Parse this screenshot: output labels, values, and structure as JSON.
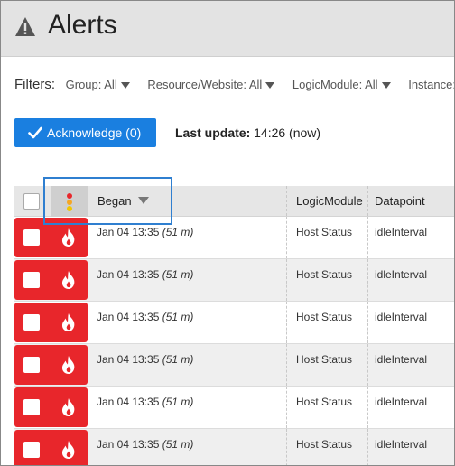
{
  "header": {
    "title": "Alerts",
    "icon": "warning-icon"
  },
  "filters": {
    "label": "Filters:",
    "items": [
      {
        "text": "Group: All"
      },
      {
        "text": "Resource/Website: All"
      },
      {
        "text": "LogicModule: All"
      },
      {
        "text": "Instance:"
      }
    ]
  },
  "toolbar": {
    "acknowledge_label": "Acknowledge (0)",
    "last_update_label": "Last update:",
    "last_update_value": " 14:26 (now)"
  },
  "table": {
    "columns": {
      "began": "Began",
      "logicmodule": "LogicModule",
      "datapoint": "Datapoint"
    },
    "rows": [
      {
        "began": "Jan 04 13:35 ",
        "duration": "(51 m)",
        "logicmodule": "Host Status",
        "datapoint": "idleInterval"
      },
      {
        "began": "Jan 04 13:35 ",
        "duration": "(51 m)",
        "logicmodule": "Host Status",
        "datapoint": "idleInterval"
      },
      {
        "began": "Jan 04 13:35 ",
        "duration": "(51 m)",
        "logicmodule": "Host Status",
        "datapoint": "idleInterval"
      },
      {
        "began": "Jan 04 13:35 ",
        "duration": "(51 m)",
        "logicmodule": "Host Status",
        "datapoint": "idleInterval"
      },
      {
        "began": "Jan 04 13:35 ",
        "duration": "(51 m)",
        "logicmodule": "Host Status",
        "datapoint": "idleInterval"
      },
      {
        "began": "Jan 04 13:35 ",
        "duration": "(51 m)",
        "logicmodule": "Host Status",
        "datapoint": "idleInterval"
      }
    ]
  },
  "colors": {
    "accent": "#1a7fe0",
    "critical": "#e8262b",
    "light_red": "#e8262b",
    "light_orange": "#f5a623",
    "light_yellow": "#f2c500",
    "focus": "#2f7fd0"
  }
}
